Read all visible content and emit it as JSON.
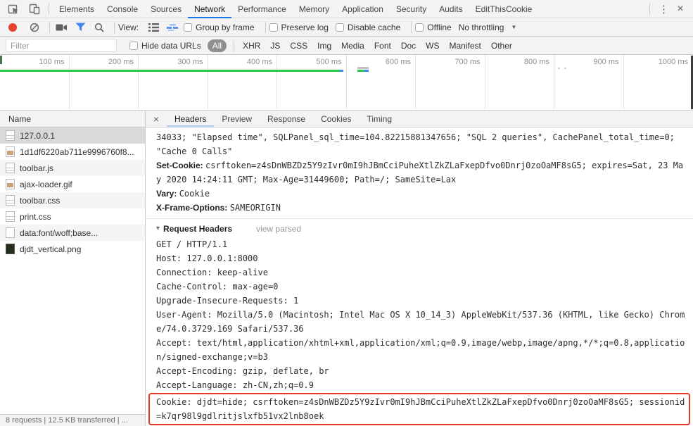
{
  "window": {
    "kebab_icon": "⋮",
    "close_icon": "×"
  },
  "tabs": {
    "items": [
      "Elements",
      "Console",
      "Sources",
      "Network",
      "Performance",
      "Memory",
      "Application",
      "Security",
      "Audits",
      "EditThisCookie"
    ],
    "active": "Network"
  },
  "toolbar": {
    "view_label": "View:",
    "group_by_frame": "Group by frame",
    "preserve_log": "Preserve log",
    "disable_cache": "Disable cache",
    "offline": "Offline",
    "throttling": "No throttling",
    "throttling_caret": "▼"
  },
  "filter": {
    "placeholder": "Filter",
    "hide_data_urls": "Hide data URLs",
    "types": [
      "All",
      "XHR",
      "JS",
      "CSS",
      "Img",
      "Media",
      "Font",
      "Doc",
      "WS",
      "Manifest",
      "Other"
    ],
    "active_type": "All"
  },
  "timeline": {
    "labels": [
      "100 ms",
      "200 ms",
      "300 ms",
      "400 ms",
      "500 ms",
      "600 ms",
      "700 ms",
      "800 ms",
      "900 ms",
      "1000 ms"
    ]
  },
  "requests": {
    "column_header": "Name",
    "items": [
      {
        "name": "127.0.0.1",
        "icon": "document-icon",
        "selected": true
      },
      {
        "name": "1d1df6220ab711e9996760f8...",
        "icon": "image-icon",
        "selected": false
      },
      {
        "name": "toolbar.js",
        "icon": "document-icon",
        "selected": false
      },
      {
        "name": "ajax-loader.gif",
        "icon": "image-icon",
        "selected": false
      },
      {
        "name": "toolbar.css",
        "icon": "document-icon",
        "selected": false
      },
      {
        "name": "print.css",
        "icon": "document-icon",
        "selected": false
      },
      {
        "name": "data:font/woff;base...",
        "icon": "blank-icon",
        "selected": false
      },
      {
        "name": "djdt_vertical.png",
        "icon": "image-dark-icon",
        "selected": false
      }
    ]
  },
  "details": {
    "close_icon": "×",
    "tabs": [
      "Headers",
      "Preview",
      "Response",
      "Cookies",
      "Timing"
    ],
    "active_tab": "Headers"
  },
  "headers": {
    "overflow_text": "34033; \"Elapsed time\", SQLPanel_sql_time=104.82215881347656; \"SQL 2 queries\", CachePanel_total_time=0; \"Cache 0 Calls\"",
    "response_headers": [
      {
        "name": "Set-Cookie:",
        "value": "csrftoken=z4sDnWBZDz5Y9zIvr0mI9hJBmCciPuheXtlZkZLaFxepDfvo0Dnrj0zoOaMF8sG5; expires=Sat, 23 May 2020 14:24:11 GMT; Max-Age=31449600; Path=/; SameSite=Lax"
      },
      {
        "name": "Vary:",
        "value": "Cookie"
      },
      {
        "name": "X-Frame-Options:",
        "value": "SAMEORIGIN"
      }
    ],
    "request_section": {
      "disclosure_icon": "▾",
      "title": "Request Headers",
      "view_parsed_label": "view parsed"
    },
    "request_raw_lines": [
      "GET / HTTP/1.1",
      "Host: 127.0.0.1:8000",
      "Connection: keep-alive",
      "Cache-Control: max-age=0",
      "Upgrade-Insecure-Requests: 1",
      "User-Agent: Mozilla/5.0 (Macintosh; Intel Mac OS X 10_14_3) AppleWebKit/537.36 (KHTML, like Gecko) Chrome/74.0.3729.169 Safari/537.36",
      "Accept: text/html,application/xhtml+xml,application/xml;q=0.9,image/webp,image/apng,*/*;q=0.8,application/signed-exchange;v=b3",
      "Accept-Encoding: gzip, deflate, br",
      "Accept-Language: zh-CN,zh;q=0.9"
    ],
    "highlighted_cookie_line": "Cookie: djdt=hide; csrftoken=z4sDnWBZDz5Y9zIvr0mI9hJBmCciPuheXtlZkZLaFxepDfvo0Dnrj0zoOaMF8sG5; sessionid=k7qr98l9gdlritjslxfb51vx2lnb8oek"
  },
  "status": {
    "text": "8 requests | 12.5 KB transferred | ..."
  },
  "colors": {
    "accent_blue": "#1a73e8",
    "record_red": "#e8402f",
    "filter_funnel_blue": "#4285f4",
    "timeline_green": "#2ec946",
    "highlight_red": "#e8382a",
    "active_subtab_underline": "#b7cfec"
  }
}
